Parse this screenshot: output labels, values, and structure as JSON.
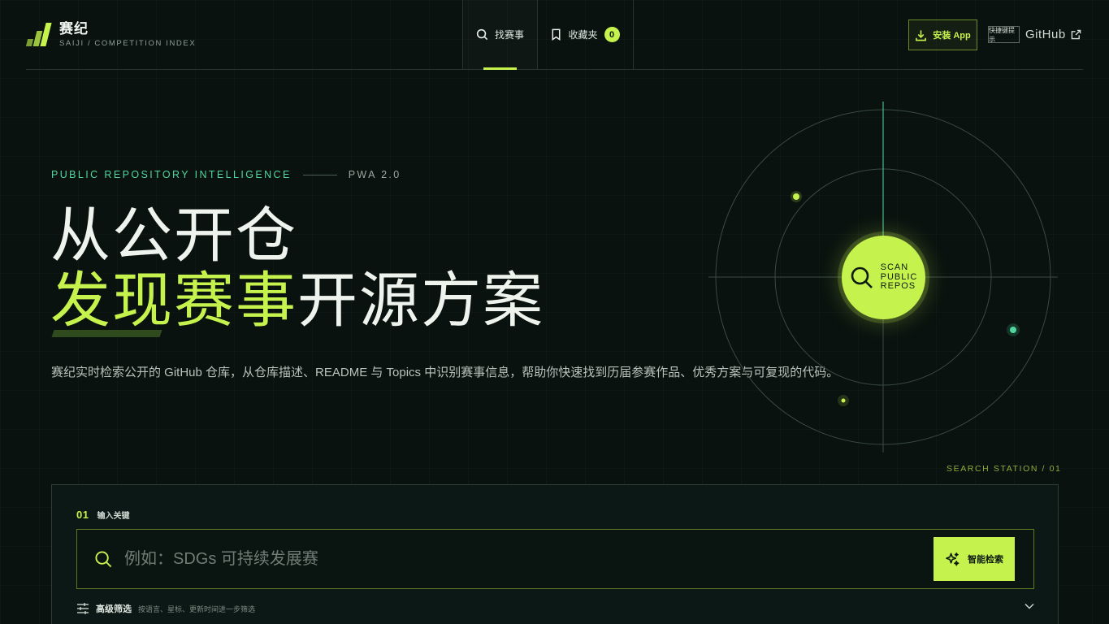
{
  "brand": {
    "name": "赛纪",
    "subtitle": "SAIJI / COMPETITION INDEX"
  },
  "nav": {
    "search_label": "找赛事",
    "saved_label": "收藏夹",
    "saved_count": "0"
  },
  "header": {
    "install_label": "安装 App",
    "shortcut_label": "快捷键提示",
    "github_label": "GitHub"
  },
  "hero": {
    "eyebrow": "PUBLIC REPOSITORY INTELLIGENCE",
    "version": "PWA 2.0",
    "title_line1": "从公开仓",
    "title_accent": "发现赛事",
    "title_rest": "开源方案",
    "description": "赛纪实时检索公开的 GitHub 仓库，从仓库描述、README 与 Topics 中识别赛事信息，帮助你快速找到历届参赛作品、优秀方案与可复现的代码。"
  },
  "radar": {
    "scan_line1": "SCAN",
    "scan_line2": "PUBLIC",
    "scan_line3": "REPOS",
    "station": "SEARCH STATION / 01"
  },
  "search": {
    "step_num": "01",
    "step_label": "输入关键",
    "placeholder": "例如：SDGs 可持续发展赛",
    "value": "",
    "button_label": "智能检索"
  },
  "filters": {
    "title": "高级筛选",
    "hint": "按语言、星标、更新时间进一步筛选"
  },
  "colors": {
    "accent": "#c6f24e",
    "teal": "#52d6a0",
    "background": "#09120f"
  }
}
